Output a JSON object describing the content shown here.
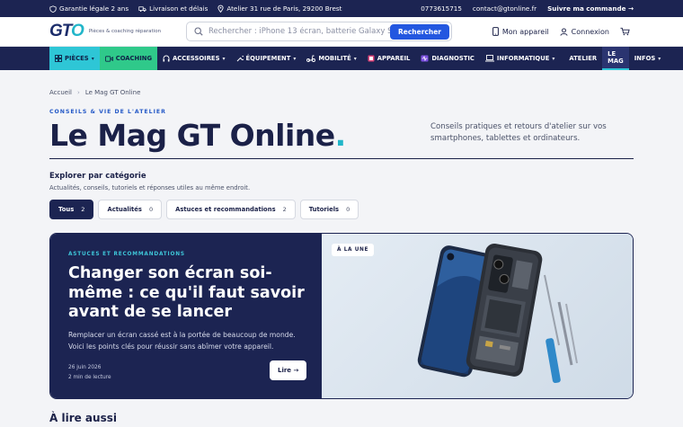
{
  "topbar": {
    "warranty": "Garantie légale 2 ans",
    "delivery": "Livraison et délais",
    "address": "Atelier 31 rue de Paris, 29200 Brest",
    "phone": "0773615715",
    "email": "contact@gtonline.fr",
    "track": "Suivre ma commande →"
  },
  "header": {
    "logo_text_a": "GT",
    "logo_text_b": "O",
    "tagline": "Pièces & coaching réparation",
    "search_placeholder": "Rechercher : iPhone 13 écran, batterie Galaxy S22...",
    "search_button": "Rechercher",
    "my_device": "Mon appareil",
    "login": "Connexion"
  },
  "nav": {
    "pieces": "PIÈCES",
    "coaching": "COACHING",
    "accessoires": "ACCESSOIRES",
    "equipement": "ÉQUIPEMENT",
    "mobilite": "MOBILITÉ",
    "appareil": "APPAREIL",
    "diagnostic": "DIAGNOSTIC",
    "informatique": "INFORMATIQUE",
    "atelier": "ATELIER",
    "lemag": "LE MAG",
    "infos": "INFOS"
  },
  "breadcrumb": {
    "home": "Accueil",
    "current": "Le Mag GT Online"
  },
  "hero": {
    "kicker": "CONSEILS & VIE DE L'ATELIER",
    "title": "Le Mag GT Online",
    "title_dot": ".",
    "intro": "Conseils pratiques et retours d'atelier sur vos smartphones, tablettes et ordinateurs."
  },
  "explore": {
    "heading": "Explorer par catégorie",
    "subtitle": "Actualités, conseils, tutoriels et réponses utiles au même endroit.",
    "chips": [
      {
        "label": "Tous",
        "count": "2"
      },
      {
        "label": "Actualités",
        "count": "0"
      },
      {
        "label": "Astuces et recommandations",
        "count": "2"
      },
      {
        "label": "Tutoriels",
        "count": "0"
      }
    ]
  },
  "feature": {
    "category": "ASTUCES ET RECOMMANDATIONS",
    "title": "Changer son écran soi-même : ce qu'il faut savoir avant de se lancer",
    "excerpt": "Remplacer un écran cassé est à la portée de beaucoup de monde. Voici les points clés pour réussir sans abîmer votre appareil.",
    "date": "26 juin 2026",
    "read_time": "2 min de lecture",
    "read_button": "Lire →",
    "badge": "À LA UNE"
  },
  "next_section": "À lire aussi",
  "colors": {
    "navy": "#1c2452",
    "cyan": "#22b6c9",
    "green": "#2fc98a",
    "blue": "#2357e0"
  }
}
